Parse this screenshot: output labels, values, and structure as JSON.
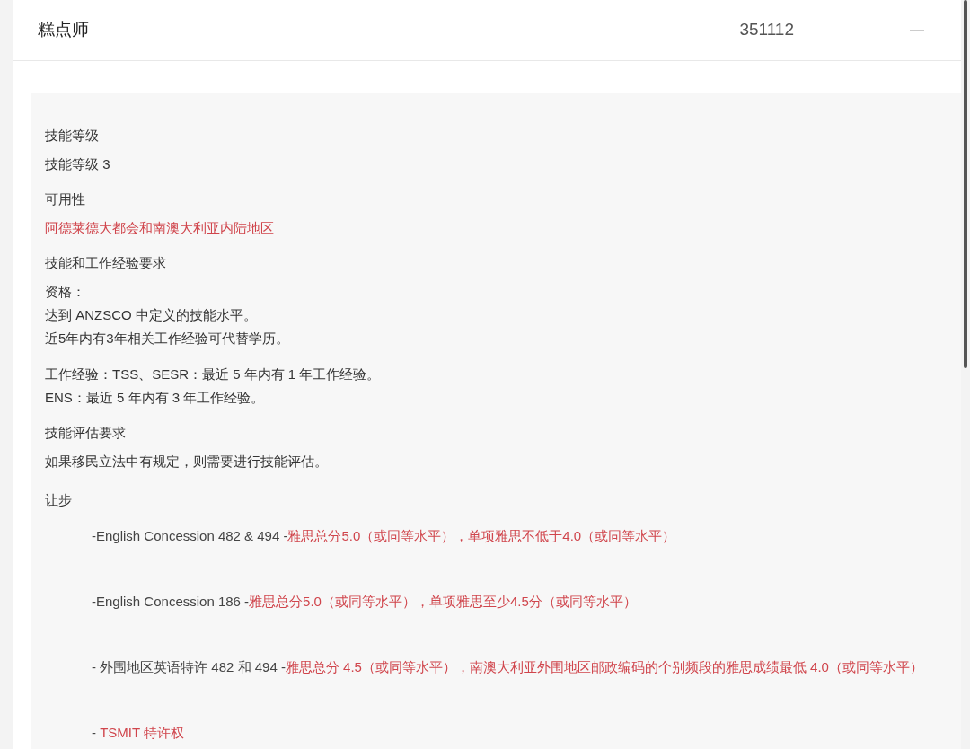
{
  "header": {
    "title": "糕点师",
    "code": "351112",
    "expanded": true
  },
  "sections": [
    {
      "heading": "技能等级",
      "lines": [
        {
          "kind": "plain",
          "text": "技能等级 3"
        }
      ]
    },
    {
      "heading": "可用性",
      "lines": [
        {
          "kind": "accent",
          "text": "阿德莱德大都会和南澳大利亚内陆地区"
        }
      ]
    },
    {
      "heading": "技能和工作经验要求",
      "lines": [
        {
          "kind": "plain",
          "text": "资格："
        },
        {
          "kind": "plain",
          "text": "达到 ANZSCO 中定义的技能水平。"
        },
        {
          "kind": "plain",
          "text": "近5年内有3年相关工作经验可代替学历。"
        },
        {
          "kind": "gap"
        },
        {
          "kind": "plain",
          "text": "工作经验：TSS、SESR：最近 5 年内有 1 年工作经验。"
        },
        {
          "kind": "plain",
          "text": "ENS：最近 5 年内有 3 年工作经验。"
        }
      ]
    },
    {
      "heading": "技能评估要求",
      "lines": [
        {
          "kind": "plain",
          "text": "如果移民立法中有规定，则需要进行技能评估。"
        }
      ]
    }
  ],
  "concessions": {
    "heading": "让步",
    "items": [
      {
        "prefix": "-English Concession 482 & 494 -",
        "detail": "雅思总分5.0（或同等水平），单项雅思不低于4.0（或同等水平）"
      },
      {
        "prefix": "-English Concession 186 -",
        "detail": "雅思总分5.0（或同等水平），单项雅思至少4.5分（或同等水平）"
      },
      {
        "prefix": "- 外围地区英语特许 482 和 494 -",
        "detail": "雅思总分 4.5（或同等水平），南澳大利亚外围地区邮政编码的个别频段的雅思成绩最低 4.0（或同等水平）"
      },
      {
        "prefix": "- ",
        "detail": "TSMIT 特许权"
      }
    ]
  }
}
